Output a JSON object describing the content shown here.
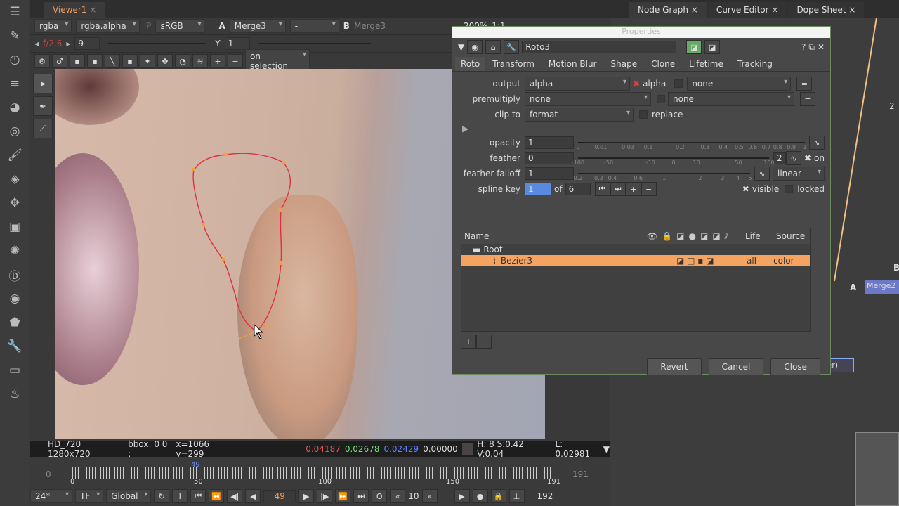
{
  "left_toolbar": [
    "menu-icon",
    "paint-icon",
    "clock-icon",
    "layers-icon",
    "sphere-icon",
    "circle-icon",
    "brush-icon",
    "stack-icon",
    "move-icon",
    "cube-icon",
    "particle-icon",
    "d-icon",
    "eye-icon",
    "tag-icon",
    "wrench-icon",
    "drive-icon",
    "flame-icon"
  ],
  "viewer": {
    "tab": "Viewer1",
    "channels": "rgba",
    "alpha": "rgba.alpha",
    "ip": "IP",
    "colorspace": "sRGB",
    "a_label": "A",
    "a_input": "Merge3",
    "blend": "-",
    "b_label": "B",
    "b_input": "Merge3",
    "zoom": "200%",
    "proxy": "1:1",
    "fstop": "f/2.6",
    "gain": "9",
    "gamma_label": "Y",
    "gamma": "1",
    "selection_mode": "on selection"
  },
  "info": {
    "format": "HD_720 1280x720",
    "bbox": "bbox: 0 0 :",
    "coords": "x=1066 y=299",
    "r": "0.04187",
    "g": "0.02678",
    "b": "0.02429",
    "a": "0.00000",
    "hsv": "H:  8 S:0.42 V:0.04",
    "l": "L: 0.02981"
  },
  "timeline": {
    "start": "0",
    "end": "191",
    "current_marker": "49",
    "ticks": [
      "0",
      "50",
      "100",
      "150",
      "191"
    ],
    "fps": "24*",
    "tf": "TF",
    "global": "Global",
    "frame": "49",
    "increment": "10",
    "end_frame": "192",
    "current_fraction": 0.2565
  },
  "node_graph": {
    "tabs": [
      "Node Graph",
      "Curve Editor",
      "Dope Sheet"
    ],
    "node_label": "Merge2",
    "input_a": "A",
    "input_b": "B",
    "label_2": "2",
    "viewer_node": "ver)"
  },
  "properties": {
    "title": "Properties",
    "node_name": "Roto3",
    "tabs": [
      "Roto",
      "Transform",
      "Motion Blur",
      "Shape",
      "Clone",
      "Lifetime",
      "Tracking"
    ],
    "output_label": "output",
    "output": "alpha",
    "alpha_check": "alpha",
    "output_extra": "none",
    "premult_label": "premultiply",
    "premult": "none",
    "premult_extra": "none",
    "clip_label": "clip to",
    "clip": "format",
    "replace": "replace",
    "opacity_label": "opacity",
    "opacity": "1",
    "opacity_ticks": [
      "0",
      "0.01",
      "0.03",
      "0.1",
      "0.2",
      "0.3",
      "0.4",
      "0.5",
      "0.6",
      "0.7",
      "0.8",
      "0.9",
      "1"
    ],
    "feather_label": "feather",
    "feather": "0",
    "feather_ticks": [
      "-100",
      "-50",
      "-10",
      "0",
      "10",
      "50",
      "100"
    ],
    "feather_count": "2",
    "on": "on",
    "falloff_label": "feather falloff",
    "falloff": "1",
    "falloff_ticks": [
      "0.2",
      "0.3",
      "0.4",
      "0.6",
      "1",
      "2",
      "3",
      "4",
      "5"
    ],
    "falloff_type": "linear",
    "spline_label": "spline key",
    "spline_key": "1",
    "of": "of",
    "spline_total": "6",
    "visible": "visible",
    "locked": "locked",
    "columns": [
      "Name",
      "Life",
      "Source"
    ],
    "rows": [
      {
        "name": "Root"
      },
      {
        "name": "Bezier3",
        "life": "all",
        "source": "color"
      }
    ],
    "revert": "Revert",
    "cancel": "Cancel",
    "close": "Close"
  },
  "colors": {
    "accent_orange": "#f4a058",
    "curve_red": "#e03040",
    "selection_row": "#f4a460"
  }
}
